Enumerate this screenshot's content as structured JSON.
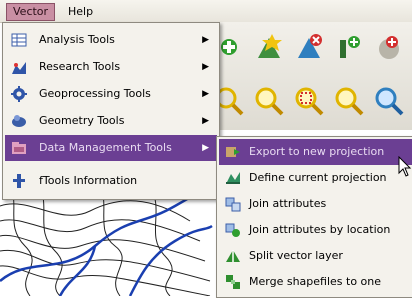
{
  "menubar": {
    "items": [
      "Vector",
      "Help"
    ]
  },
  "menu": {
    "items": [
      {
        "label": "Analysis Tools",
        "icon": "analysis-tools-icon",
        "has_submenu": true
      },
      {
        "label": "Research Tools",
        "icon": "research-tools-icon",
        "has_submenu": true
      },
      {
        "label": "Geoprocessing Tools",
        "icon": "geoprocessing-tools-icon",
        "has_submenu": true
      },
      {
        "label": "Geometry Tools",
        "icon": "geometry-tools-icon",
        "has_submenu": true
      },
      {
        "label": "Data Management Tools",
        "icon": "data-management-tools-icon",
        "has_submenu": true,
        "selected": true
      },
      {
        "label": "fTools Information",
        "icon": "ftools-information-icon",
        "has_submenu": false
      }
    ],
    "arrow": "▶"
  },
  "submenu": {
    "items": [
      {
        "label": "Export to new projection",
        "icon": "export-projection-icon",
        "selected": true
      },
      {
        "label": "Define current projection",
        "icon": "define-projection-icon"
      },
      {
        "label": "Join attributes",
        "icon": "join-attributes-icon"
      },
      {
        "label": "Join attributes by location",
        "icon": "join-location-icon"
      },
      {
        "label": "Split vector layer",
        "icon": "split-layer-icon"
      },
      {
        "label": "Merge shapefiles to one",
        "icon": "merge-shapefiles-icon"
      }
    ]
  },
  "colors": {
    "highlight": "#6b3f93",
    "menu_bg": "#f4f2ec",
    "vector_menu_bg": "#c98fa3"
  }
}
